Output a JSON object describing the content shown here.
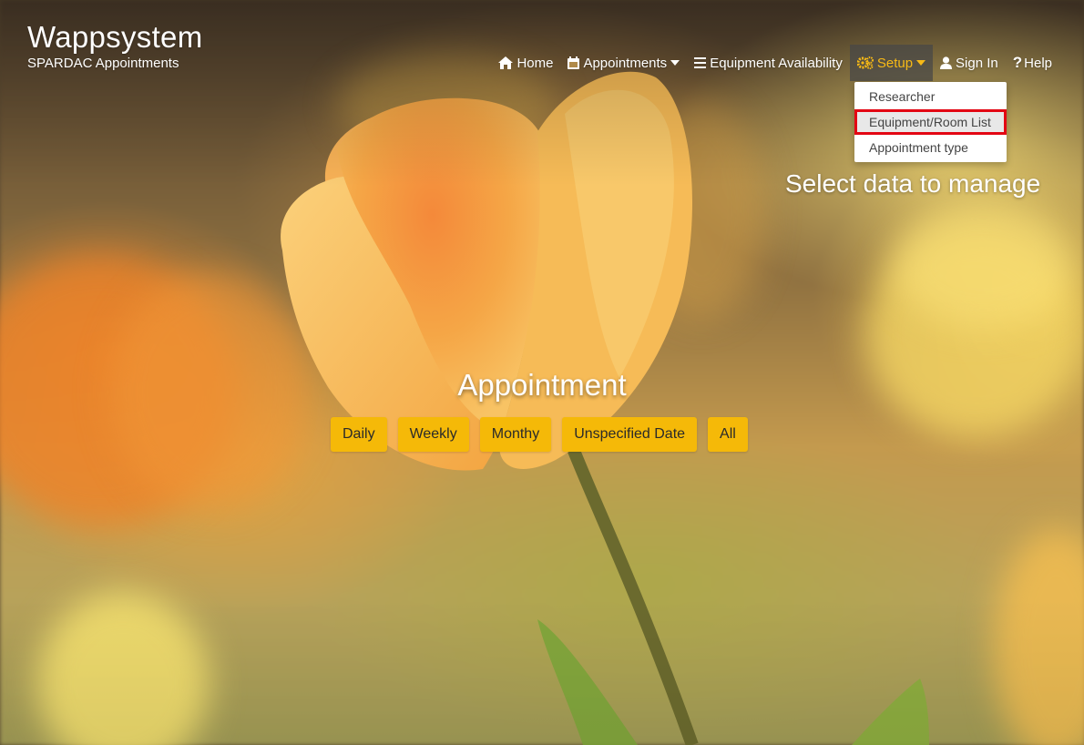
{
  "brand": {
    "title": "Wappsystem",
    "subtitle": "SPARDAC Appointments"
  },
  "nav": {
    "home": {
      "label": "Home",
      "icon": "home-icon"
    },
    "appointments": {
      "label": "Appointments",
      "icon": "calendar-icon"
    },
    "equipment": {
      "label": "Equipment Availability",
      "icon": "list-icon"
    },
    "setup": {
      "label": "Setup",
      "icon": "cogs-icon"
    },
    "signin": {
      "label": "Sign In",
      "icon": "user-icon"
    },
    "help": {
      "label": "Help",
      "icon": "question-icon"
    }
  },
  "setup_menu": {
    "items": [
      {
        "label": "Researcher"
      },
      {
        "label": "Equipment/Room List",
        "highlighted": true
      },
      {
        "label": "Appointment type"
      }
    ]
  },
  "annotation": "Select data to manage",
  "main": {
    "title": "Appointment",
    "buttons": [
      {
        "label": "Daily"
      },
      {
        "label": "Weekly"
      },
      {
        "label": "Monthy"
      },
      {
        "label": "Unspecified Date"
      },
      {
        "label": "All"
      }
    ]
  },
  "colors": {
    "accent": "#f5b908",
    "setup_active_text": "#f7b916",
    "highlight_border": "#e30613"
  }
}
